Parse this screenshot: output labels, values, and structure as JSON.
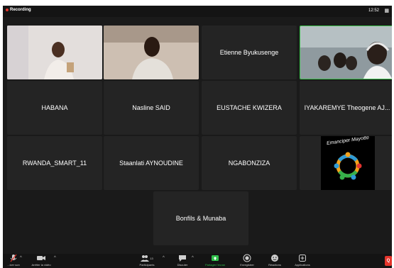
{
  "topbar": {
    "recording_label": "Recording",
    "time": "12:52",
    "view_icon": "grid-view-icon"
  },
  "participants": [
    {
      "name": "",
      "type": "video"
    },
    {
      "name": "",
      "type": "video"
    },
    {
      "name": "Etienne Byukusenge",
      "type": "name"
    },
    {
      "name": "",
      "type": "video",
      "active_speaker": true
    },
    {
      "name": "HABANA",
      "type": "name"
    },
    {
      "name": "Nasline SAID",
      "type": "name"
    },
    {
      "name": "EUSTACHE KWIZERA",
      "type": "name"
    },
    {
      "name": "IYAKAREMYE Theogene AJ...",
      "type": "name"
    },
    {
      "name": "RWANDA_SMART_11",
      "type": "name"
    },
    {
      "name": "Staanlati AYNOUDINE",
      "type": "name"
    },
    {
      "name": "NGABONZIZA",
      "type": "name"
    },
    {
      "name": "",
      "type": "logo",
      "logo_text": "Emanciper Mayotte"
    },
    {
      "name": "Bonfils & Munaba",
      "type": "name"
    }
  ],
  "toolbar": {
    "mute_label": "...iver son",
    "video_label": "Arrêter la vidéo",
    "participants_label": "Participants",
    "participants_count": "13",
    "chat_label": "Discuter",
    "share_label": "Partager l'écran",
    "record_label": "Enregistrer",
    "reactions_label": "Réactions",
    "apps_label": "Applications",
    "leave_label": "Q"
  },
  "colors": {
    "active_speaker": "#3ac14a",
    "share": "#2fbf4a",
    "leave": "#e5352c"
  }
}
